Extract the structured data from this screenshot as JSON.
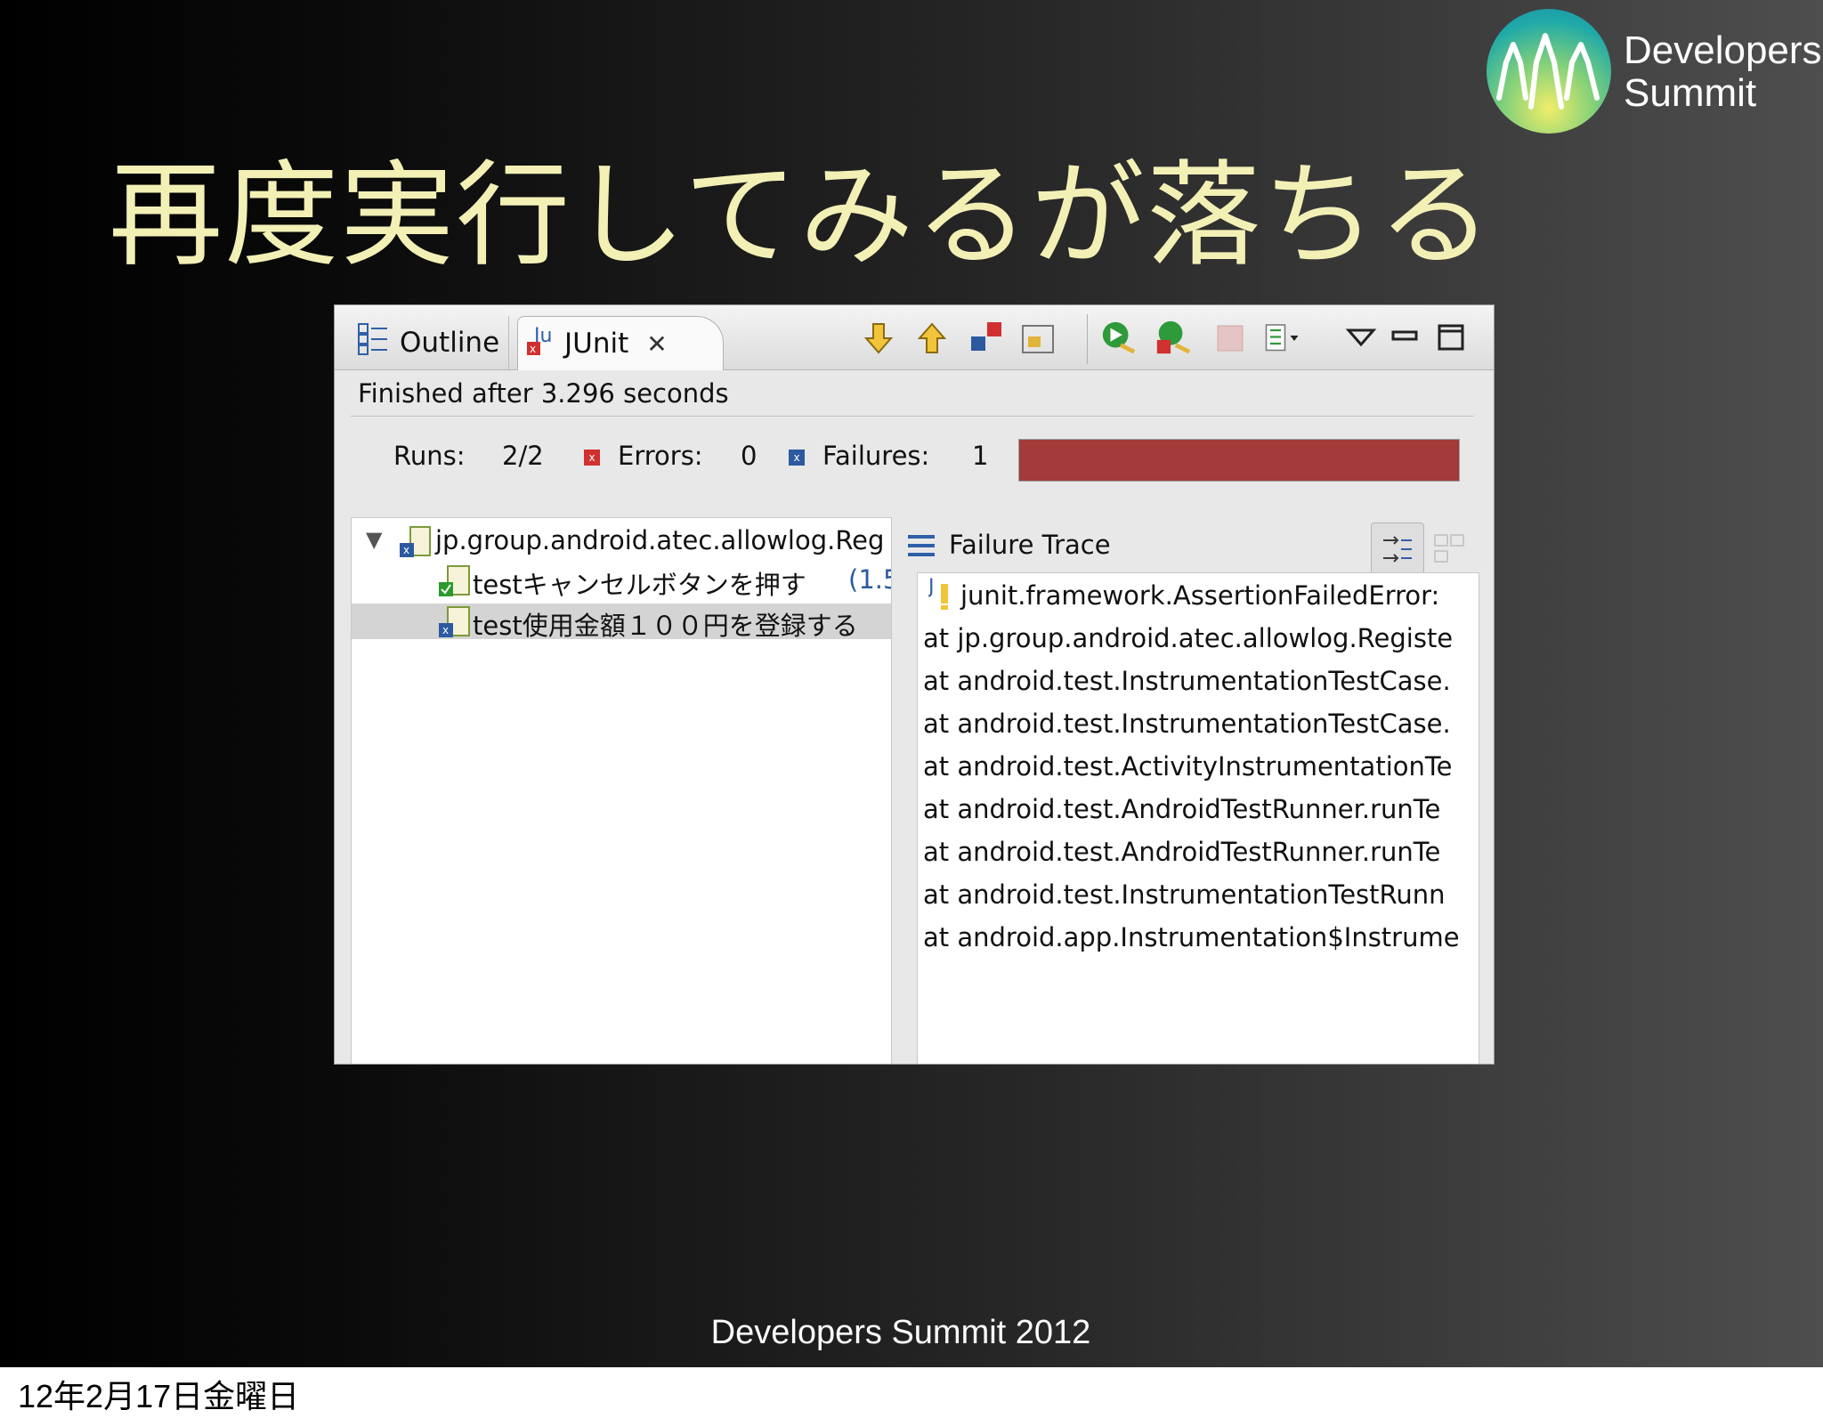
{
  "slide": {
    "title": "再度実行してみるが落ちる",
    "logo": {
      "line1": "Developers",
      "line2": "Summit"
    },
    "footer": "Developers Summit 2012",
    "date": "12年2月17日金曜日"
  },
  "colors": {
    "title": "#f3f0b6",
    "failure_bar": "#a33b3b",
    "success_check": "#2a9a2a",
    "error_red": "#d03030",
    "failure_blue": "#2c5aa0"
  },
  "tabs": {
    "outline": "Outline",
    "junit": "JUnit"
  },
  "toolbar_icons": [
    "next-failure-icon",
    "previous-failure-icon",
    "show-failures-only-icon",
    "scroll-lock-icon",
    "rerun-test-icon",
    "rerun-failed-first-icon",
    "stop-icon",
    "test-run-history-icon",
    "view-menu-icon",
    "minimize-icon",
    "maximize-icon"
  ],
  "status": "Finished after 3.296 seconds",
  "counters": {
    "runs_label": "Runs:",
    "runs_value": "2/2",
    "errors_label": "Errors:",
    "errors_value": "0",
    "failures_label": "Failures:",
    "failures_value": "1",
    "progress": 1.0
  },
  "tree": {
    "suite": "jp.group.android.atec.allowlog.Reg",
    "tests": [
      {
        "name": "testキャンセルボタンを押す",
        "time": "(1.5",
        "status": "passed"
      },
      {
        "name": "test使用金額１００円を登録する",
        "time": "",
        "status": "failed"
      }
    ]
  },
  "failure_trace": {
    "title": "Failure Trace",
    "lines": [
      "junit.framework.AssertionFailedError:",
      "at jp.group.android.atec.allowlog.Registe",
      "at android.test.InstrumentationTestCase.",
      "at android.test.InstrumentationTestCase.",
      "at android.test.ActivityInstrumentationTe",
      "at android.test.AndroidTestRunner.runTe",
      "at android.test.AndroidTestRunner.runTe",
      "at android.test.InstrumentationTestRunn",
      "at android.app.Instrumentation$Instrume"
    ]
  }
}
